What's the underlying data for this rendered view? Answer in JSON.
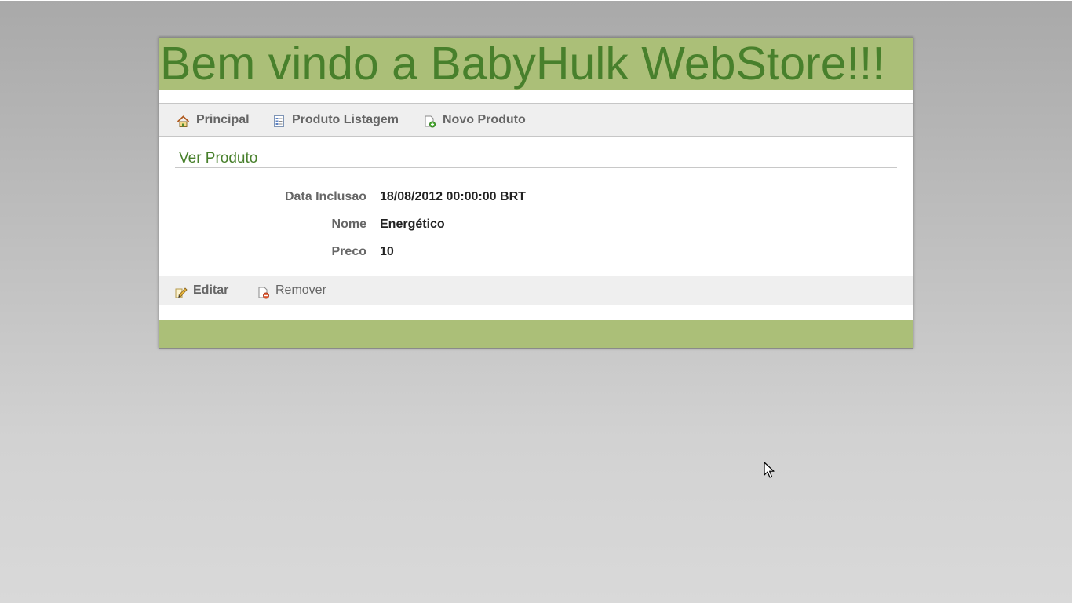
{
  "header": {
    "title": "Bem vindo a BabyHulk WebStore!!!"
  },
  "nav": {
    "items": [
      {
        "label": "Principal",
        "icon": "home-icon"
      },
      {
        "label": "Produto Listagem",
        "icon": "list-icon"
      },
      {
        "label": "Novo Produto",
        "icon": "new-document-icon"
      }
    ]
  },
  "content": {
    "title": "Ver Produto",
    "properties": [
      {
        "name": "Data Inclusao",
        "value": "18/08/2012 00:00:00 BRT"
      },
      {
        "name": "Nome",
        "value": "Energético"
      },
      {
        "name": "Preco",
        "value": "10"
      }
    ]
  },
  "actions": {
    "edit_label": "Editar",
    "remove_label": "Remover"
  },
  "colors": {
    "brand_green": "#abbf78",
    "title_green": "#48802c",
    "page_background": "#c4c4c4"
  }
}
